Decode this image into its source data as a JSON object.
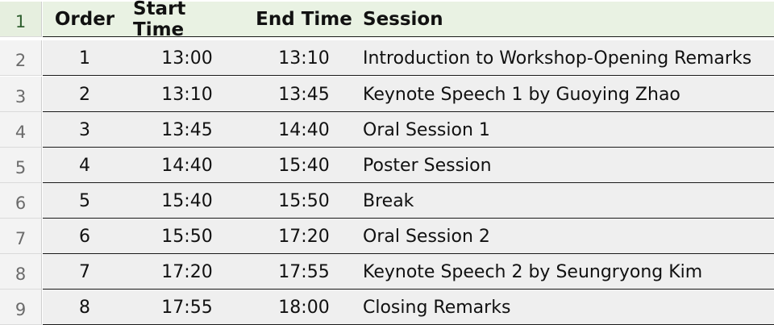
{
  "row_numbers": [
    "1",
    "2",
    "3",
    "4",
    "5",
    "6",
    "7",
    "8",
    "9"
  ],
  "headers": {
    "order": "Order",
    "start": "Start Time",
    "end": "End Time",
    "session": "Session"
  },
  "rows": [
    {
      "order": "1",
      "start": "13:00",
      "end": "13:10",
      "session": "Introduction to Workshop-Opening Remarks"
    },
    {
      "order": "2",
      "start": "13:10",
      "end": "13:45",
      "session": "Keynote Speech 1 by Guoying Zhao"
    },
    {
      "order": "3",
      "start": "13:45",
      "end": "14:40",
      "session": "Oral Session 1"
    },
    {
      "order": "4",
      "start": "14:40",
      "end": "15:40",
      "session": "Poster Session"
    },
    {
      "order": "5",
      "start": "15:40",
      "end": "15:50",
      "session": "Break"
    },
    {
      "order": "6",
      "start": "15:50",
      "end": "17:20",
      "session": "Oral Session 2"
    },
    {
      "order": "7",
      "start": "17:20",
      "end": "17:55",
      "session": "Keynote Speech 2 by Seungryong Kim"
    },
    {
      "order": "8",
      "start": "17:55",
      "end": "18:00",
      "session": "Closing Remarks"
    }
  ],
  "colors": {
    "header_bg": "#e9f2e3",
    "row_bg": "#efefef",
    "gutter_bg": "#f3f3f3",
    "border": "#1a1a1a"
  }
}
